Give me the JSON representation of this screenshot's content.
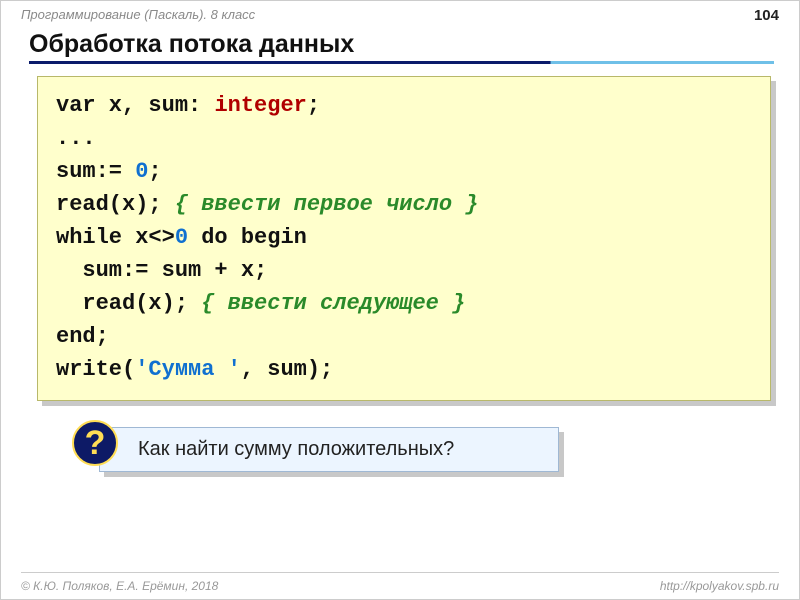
{
  "header": {
    "breadcrumb": "Программирование (Паскаль). 8 класс",
    "page_number": "104"
  },
  "title": "Обработка потока данных",
  "code": {
    "l1_a": "var x, sum: ",
    "l1_type": "integer",
    "l1_b": ";",
    "l2": "...",
    "l3_a": "sum:= ",
    "l3_num": "0",
    "l3_b": ";",
    "l4_a": "read(x); ",
    "l4_cmt": "{ ввести первое число }",
    "l5_a": "while x<>",
    "l5_num": "0",
    "l5_b": " do begin",
    "l6": "  sum:= sum + x;",
    "l7_a": "  read(x); ",
    "l7_cmt": "{ ввести следующее }",
    "l8": "end;",
    "l9_a": "write(",
    "l9_str": "'Сумма '",
    "l9_b": ", sum);"
  },
  "prompt": {
    "icon": "?",
    "text": " Как найти сумму положительных?"
  },
  "footer": {
    "left": "© К.Ю. Поляков, Е.А. Ерёмин, 2018",
    "right": "http://kpolyakov.spb.ru"
  }
}
